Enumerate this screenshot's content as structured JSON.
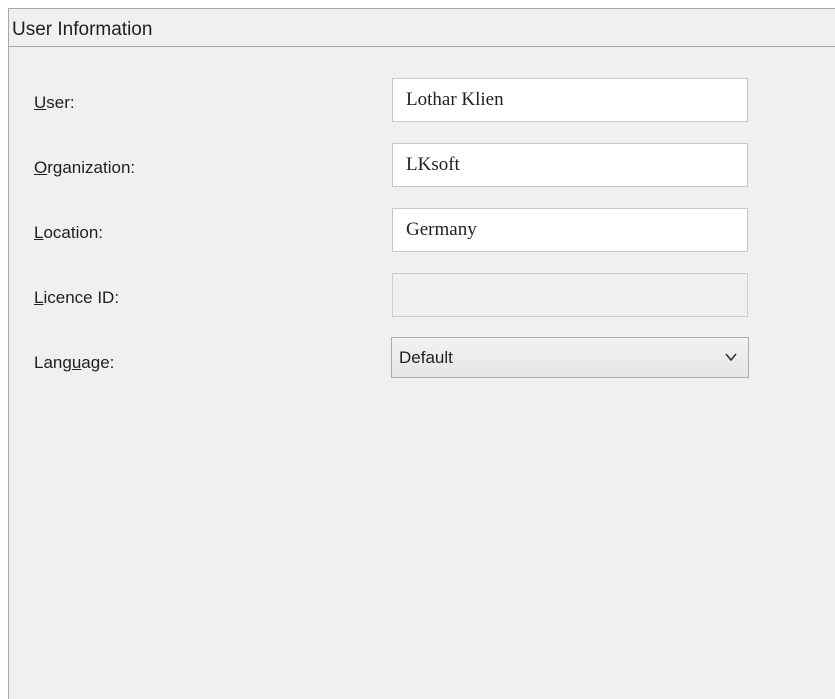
{
  "panel": {
    "title": "User Information"
  },
  "fields": {
    "user": {
      "label_accel": "U",
      "label_rest": "ser:",
      "value": "Lothar Klien"
    },
    "organization": {
      "label_accel": "O",
      "label_rest": "rganization:",
      "value": "LKsoft"
    },
    "location": {
      "label_accel": "L",
      "label_rest": "ocation:",
      "value": "Germany"
    },
    "licence_id": {
      "label_accel": "L",
      "label_rest": "icence ID:",
      "value": "",
      "disabled": true
    },
    "language": {
      "label_pre": "Lang",
      "label_accel": "u",
      "label_post": "age:",
      "selected": "Default"
    }
  },
  "icons": {
    "dropdown": "chevron-down-icon"
  }
}
